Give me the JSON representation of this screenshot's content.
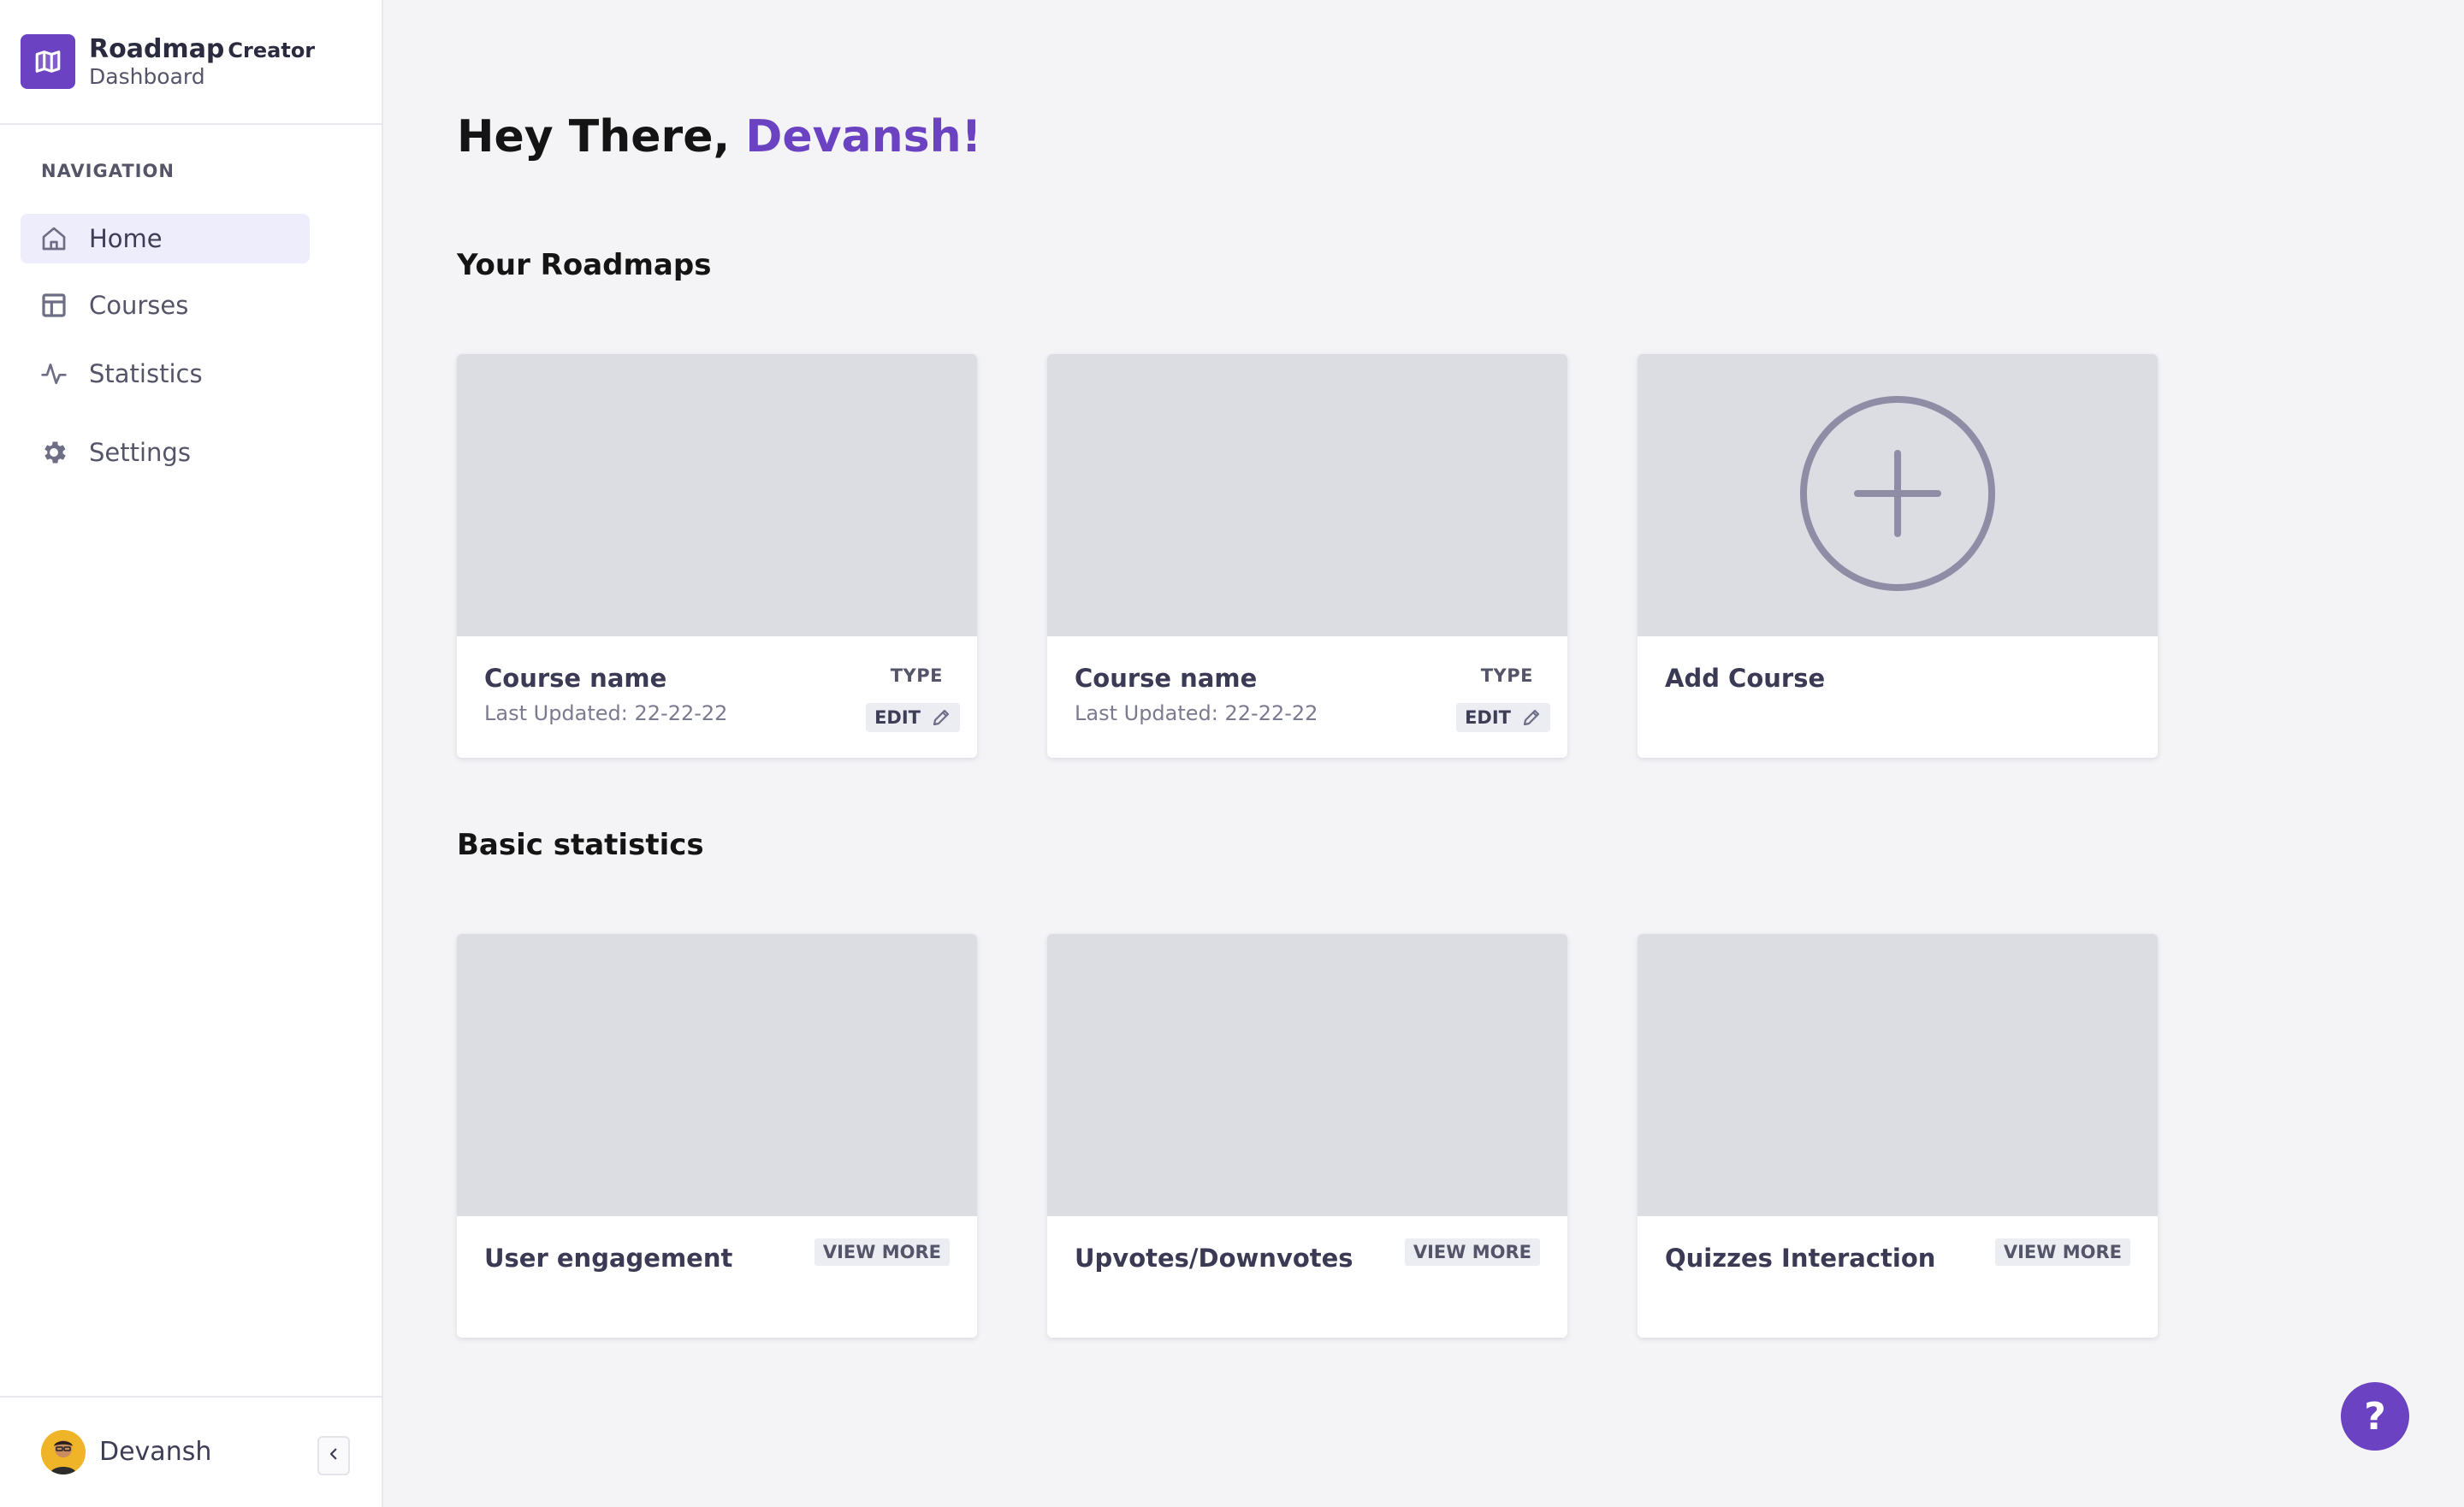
{
  "brand": {
    "title": "Roadmap",
    "title_suffix": "Creator",
    "subtitle": "Dashboard",
    "icon": "map-icon",
    "color": "#6a42c2"
  },
  "sidebar": {
    "heading": "NAVIGATION",
    "items": [
      {
        "label": "Home",
        "icon": "home-icon",
        "active": true
      },
      {
        "label": "Courses",
        "icon": "layout-icon",
        "active": false
      },
      {
        "label": "Statistics",
        "icon": "activity-icon",
        "active": false
      },
      {
        "label": "Settings",
        "icon": "gear-icon",
        "active": false
      }
    ]
  },
  "user": {
    "name": "Devansh",
    "collapse_icon": "chevron-left-icon"
  },
  "greeting": {
    "prefix": "Hey There,",
    "name": "Devansh!"
  },
  "roadmaps": {
    "title": "Your Roadmaps",
    "cards": [
      {
        "title": "Course name",
        "updated": "Last Updated: 22-22-22",
        "type": "TYPE",
        "edit": "EDIT"
      },
      {
        "title": "Course name",
        "updated": "Last Updated: 22-22-22",
        "type": "TYPE",
        "edit": "EDIT"
      }
    ],
    "add_card": {
      "title": "Add Course",
      "icon": "plus-circle-icon"
    }
  },
  "statistics": {
    "title": "Basic statistics",
    "cards": [
      {
        "title": "User engagement",
        "action": "VIEW MORE"
      },
      {
        "title": "Upvotes/Downvotes",
        "action": "VIEW MORE"
      },
      {
        "title": "Quizzes Interaction",
        "action": "VIEW MORE"
      }
    ]
  },
  "help": {
    "label": "?",
    "icon": "help-icon"
  },
  "colors": {
    "accent": "#6a42c2",
    "placeholder": "#dcdce3",
    "background": "#f4f4f7"
  }
}
